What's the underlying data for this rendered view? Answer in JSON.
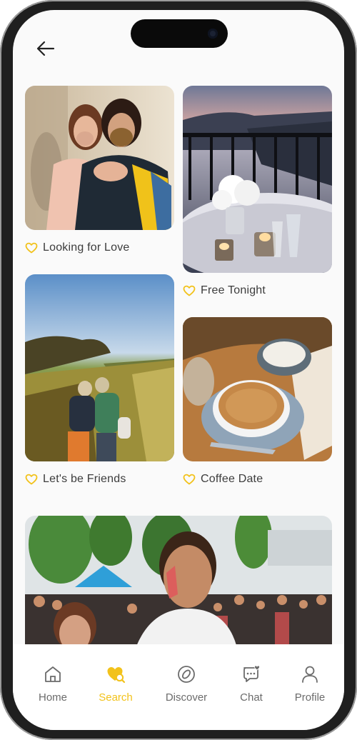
{
  "colors": {
    "accent": "#f2c21b",
    "text": "#3c3c3c",
    "tab_inactive": "#6b6b6b"
  },
  "header": {
    "back_icon": "arrow-left-icon"
  },
  "categories": [
    {
      "label": "Looking for Love",
      "icon": "heart-icon"
    },
    {
      "label": "Free Tonight",
      "icon": "heart-icon"
    },
    {
      "label": "Let's be Friends",
      "icon": "heart-icon"
    },
    {
      "label": "Coffee Date",
      "icon": "heart-icon"
    }
  ],
  "tabbar": {
    "items": [
      {
        "label": "Home",
        "icon": "home-icon",
        "active": false
      },
      {
        "label": "Search",
        "icon": "heart-search-icon",
        "active": true
      },
      {
        "label": "Discover",
        "icon": "compass-icon",
        "active": false
      },
      {
        "label": "Chat",
        "icon": "chat-heart-icon",
        "active": false
      },
      {
        "label": "Profile",
        "icon": "user-icon",
        "active": false
      }
    ]
  }
}
